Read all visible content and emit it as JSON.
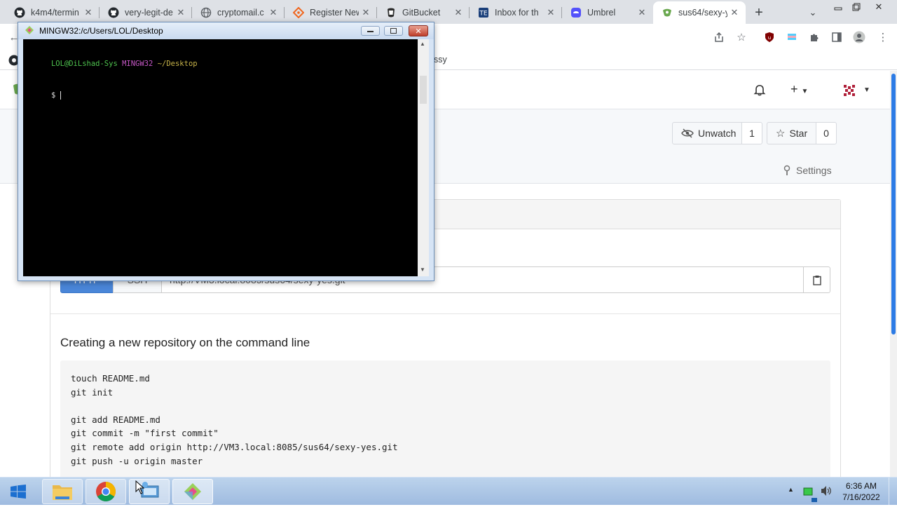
{
  "browser": {
    "tabs": [
      {
        "title": "k4m4/termin",
        "icon": "github-icon"
      },
      {
        "title": "very-legit-de",
        "icon": "github-icon"
      },
      {
        "title": "cryptomail.c",
        "icon": "globe-icon"
      },
      {
        "title": "Register New",
        "icon": "gitea-icon"
      },
      {
        "title": "GitBucket",
        "icon": "gitbucket-icon"
      },
      {
        "title": "Inbox for th",
        "icon": "tutanota-icon"
      },
      {
        "title": "Umbrel",
        "icon": "umbrel-icon"
      },
      {
        "title": "sus64/sexy-y",
        "icon": "gitbucket-icon"
      }
    ],
    "bookmark_fragment": "ssy"
  },
  "repo": {
    "watch_label": "Unwatch",
    "watch_count": "1",
    "star_label": "Star",
    "star_count": "0",
    "settings_label": "Settings"
  },
  "clone": {
    "http_label": "HTTP",
    "ssh_label": "SSH",
    "url": "http://VM3.local:8085/sus64/sexy-yes.git"
  },
  "new_repo": {
    "heading": "Creating a new repository on the command line",
    "commands": [
      "touch README.md",
      "git init",
      "",
      "git add README.md",
      "git commit -m \"first commit\"",
      "git remote add origin http://VM3.local:8085/sus64/sexy-yes.git",
      "git push -u origin master"
    ]
  },
  "terminal": {
    "title": "MINGW32:/c/Users/LOL/Desktop",
    "prompt_user": "LOL@DiLshad-Sys",
    "prompt_env": "MINGW32",
    "prompt_path": "~/Desktop",
    "prompt_symbol": "$"
  },
  "taskbar": {
    "time": "6:36 AM",
    "date": "7/16/2022"
  },
  "colors": {
    "accent": "#2c7be5",
    "prompt_green": "#4ec24e",
    "prompt_magenta": "#c658c6",
    "prompt_yellow": "#c8b44a"
  }
}
